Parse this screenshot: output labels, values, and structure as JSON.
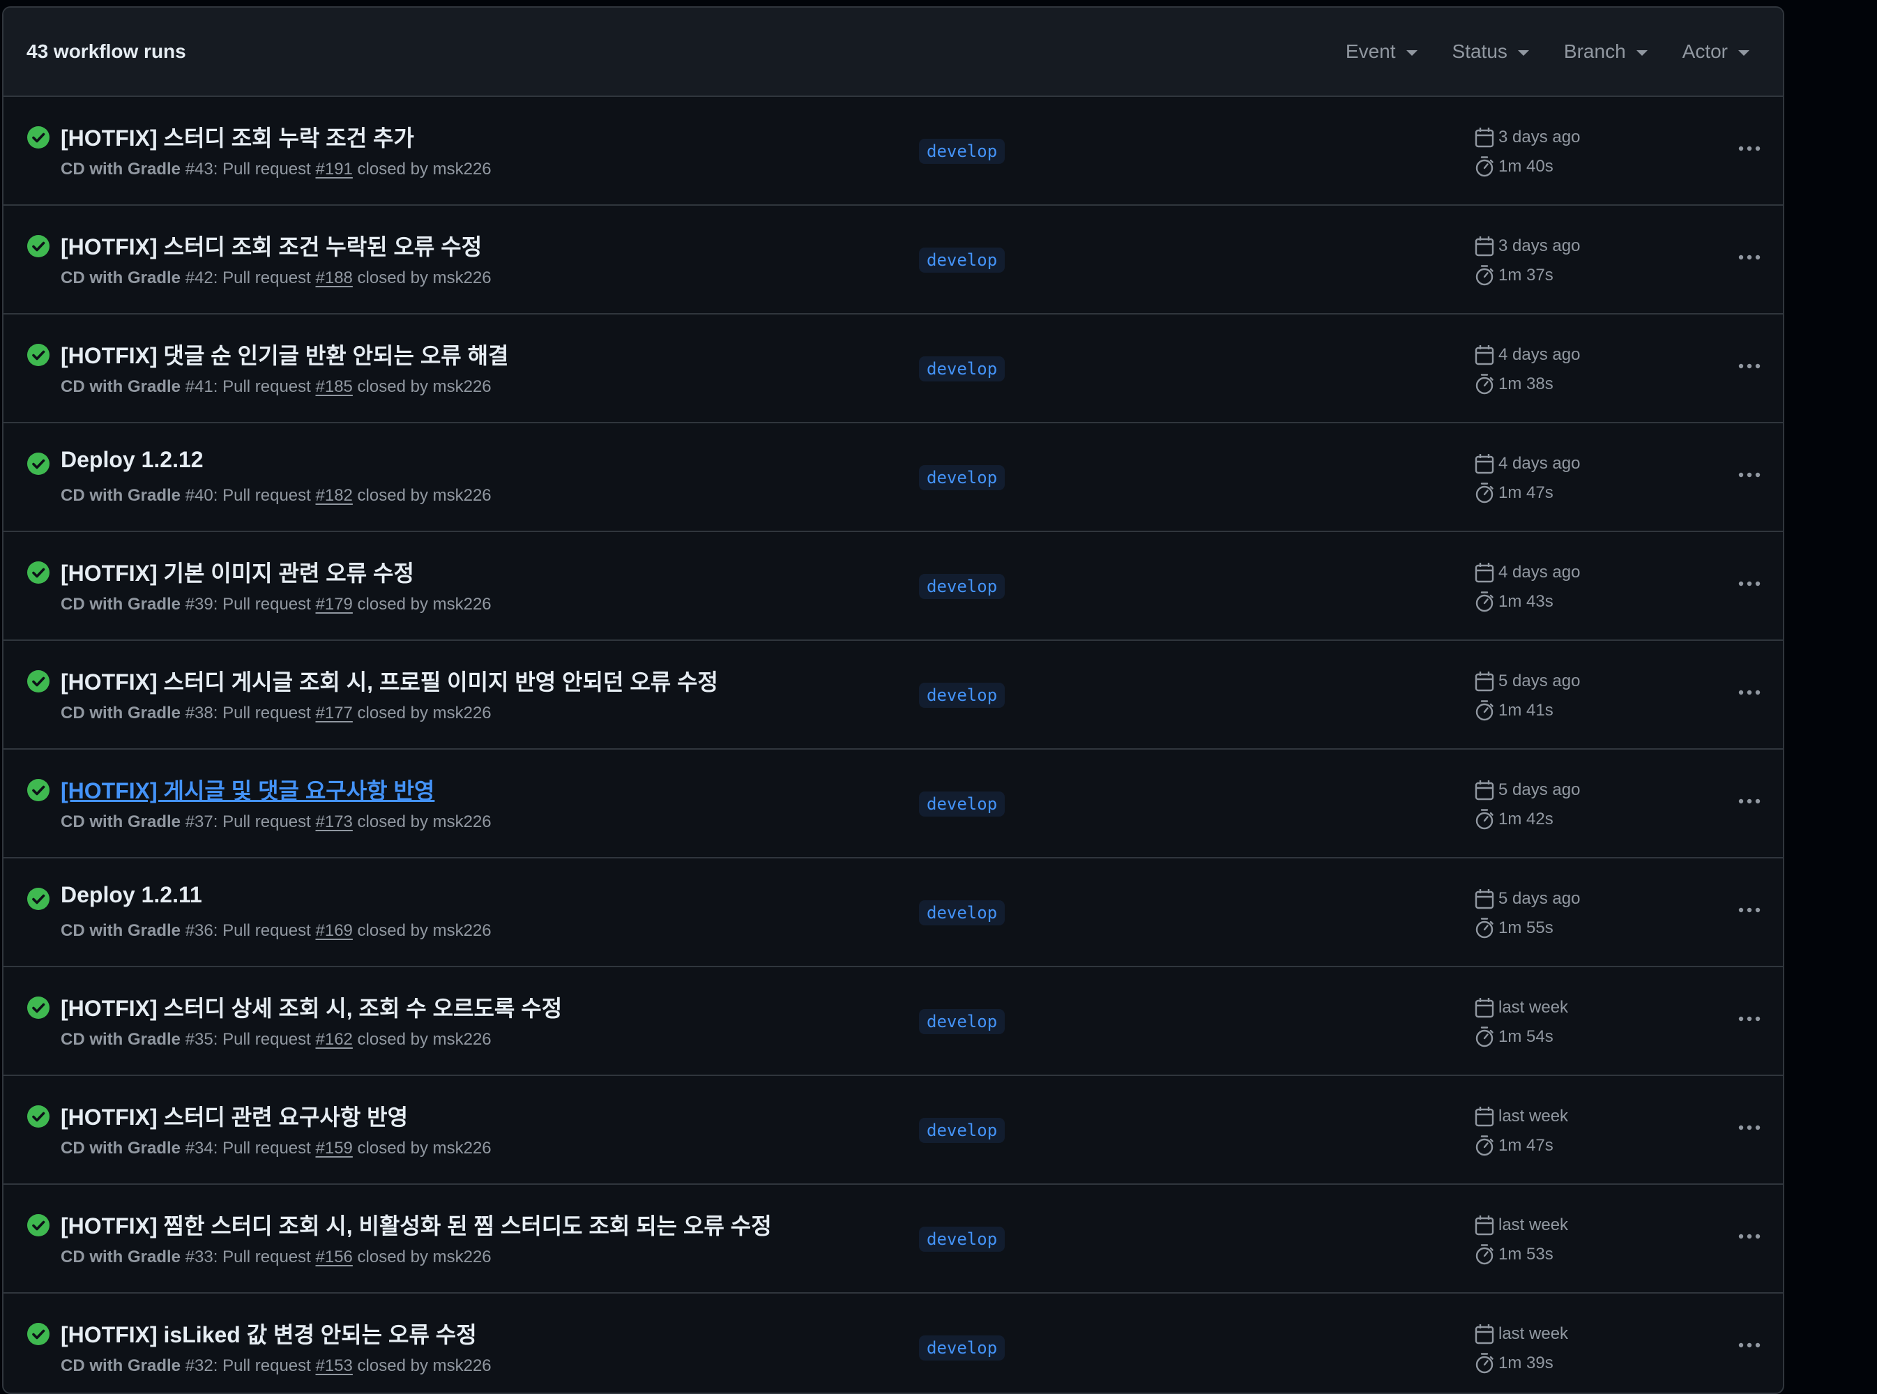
{
  "header": {
    "run_count": "43 workflow runs",
    "filters": [
      "Event",
      "Status",
      "Branch",
      "Actor"
    ]
  },
  "colors": {
    "success": "#3fb950",
    "link": "#4493f8"
  },
  "runs": [
    {
      "title": "[HOTFIX] 스터디 조회 누락 조건 추가",
      "workflow": "CD with Gradle",
      "number": "#43",
      "pr_prefix": ": Pull request ",
      "pr": "#191",
      "suffix": " closed by msk226",
      "branch": "develop",
      "time_ago": "3 days ago",
      "duration": "1m 40s"
    },
    {
      "title": "[HOTFIX] 스터디 조회 조건 누락된 오류 수정",
      "workflow": "CD with Gradle",
      "number": "#42",
      "pr_prefix": ": Pull request ",
      "pr": "#188",
      "suffix": " closed by msk226",
      "branch": "develop",
      "time_ago": "3 days ago",
      "duration": "1m 37s"
    },
    {
      "title": "[HOTFIX] 댓글 순 인기글 반환 안되는 오류 해결",
      "workflow": "CD with Gradle",
      "number": "#41",
      "pr_prefix": ": Pull request ",
      "pr": "#185",
      "suffix": " closed by msk226",
      "branch": "develop",
      "time_ago": "4 days ago",
      "duration": "1m 38s"
    },
    {
      "title": "Deploy 1.2.12",
      "workflow": "CD with Gradle",
      "number": "#40",
      "pr_prefix": ": Pull request ",
      "pr": "#182",
      "suffix": " closed by msk226",
      "branch": "develop",
      "time_ago": "4 days ago",
      "duration": "1m 47s"
    },
    {
      "title": "[HOTFIX] 기본 이미지 관련 오류 수정",
      "workflow": "CD with Gradle",
      "number": "#39",
      "pr_prefix": ": Pull request ",
      "pr": "#179",
      "suffix": " closed by msk226",
      "branch": "develop",
      "time_ago": "4 days ago",
      "duration": "1m 43s"
    },
    {
      "title": "[HOTFIX] 스터디 게시글 조회 시, 프로필 이미지 반영 안되던 오류 수정",
      "workflow": "CD with Gradle",
      "number": "#38",
      "pr_prefix": ": Pull request ",
      "pr": "#177",
      "suffix": " closed by msk226",
      "branch": "develop",
      "time_ago": "5 days ago",
      "duration": "1m 41s"
    },
    {
      "title": "[HOTFIX] 게시글 및 댓글 요구사항 반영",
      "workflow": "CD with Gradle",
      "number": "#37",
      "pr_prefix": ": Pull request ",
      "pr": "#173",
      "suffix": " closed by msk226",
      "branch": "develop",
      "time_ago": "5 days ago",
      "duration": "1m 42s",
      "hovered": true
    },
    {
      "title": "Deploy 1.2.11",
      "workflow": "CD with Gradle",
      "number": "#36",
      "pr_prefix": ": Pull request ",
      "pr": "#169",
      "suffix": " closed by msk226",
      "branch": "develop",
      "time_ago": "5 days ago",
      "duration": "1m 55s"
    },
    {
      "title": "[HOTFIX] 스터디 상세 조회 시, 조회 수 오르도록 수정",
      "workflow": "CD with Gradle",
      "number": "#35",
      "pr_prefix": ": Pull request ",
      "pr": "#162",
      "suffix": " closed by msk226",
      "branch": "develop",
      "time_ago": "last week",
      "duration": "1m 54s"
    },
    {
      "title": "[HOTFIX] 스터디 관련 요구사항 반영",
      "workflow": "CD with Gradle",
      "number": "#34",
      "pr_prefix": ": Pull request ",
      "pr": "#159",
      "suffix": " closed by msk226",
      "branch": "develop",
      "time_ago": "last week",
      "duration": "1m 47s"
    },
    {
      "title": "[HOTFIX] 찜한 스터디 조회 시, 비활성화 된 찜 스터디도 조회 되는 오류 수정",
      "workflow": "CD with Gradle",
      "number": "#33",
      "pr_prefix": ": Pull request ",
      "pr": "#156",
      "suffix": " closed by msk226",
      "branch": "develop",
      "time_ago": "last week",
      "duration": "1m 53s"
    },
    {
      "title": "[HOTFIX] isLiked 값 변경 안되는 오류 수정",
      "workflow": "CD with Gradle",
      "number": "#32",
      "pr_prefix": ": Pull request ",
      "pr": "#153",
      "suffix": " closed by msk226",
      "branch": "develop",
      "time_ago": "last week",
      "duration": "1m 39s"
    }
  ]
}
